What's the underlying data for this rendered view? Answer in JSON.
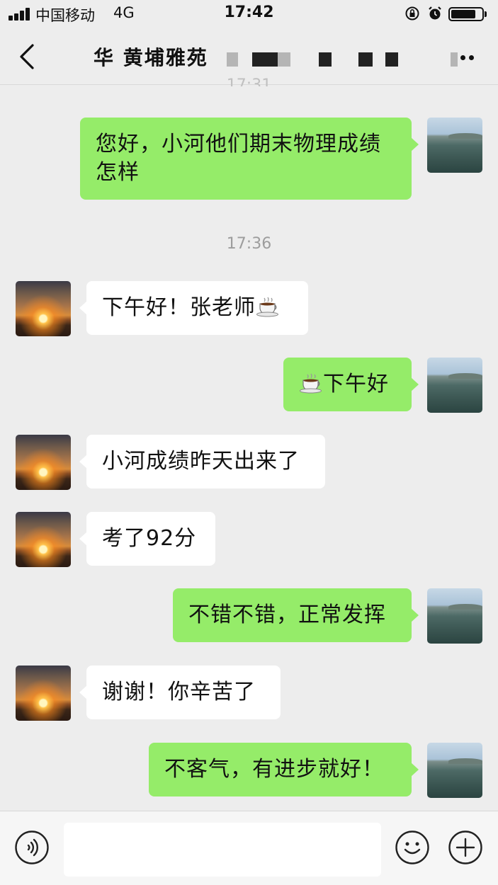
{
  "status_bar": {
    "carrier": "中国移动",
    "network": "4G",
    "time": "17:42",
    "battery_level": 0.8
  },
  "header": {
    "title": "华 黄埔雅苑",
    "back_icon": "chevron-left-icon",
    "more_icon": "more-icon"
  },
  "ghost_time": "17:31",
  "messages": [
    {
      "side": "out",
      "text": "您好，小河他们期末物理成绩\n怎样"
    },
    {
      "type": "time",
      "text": "17:36"
    },
    {
      "side": "in",
      "text": "下午好！张老师",
      "emoji": "coffee-icon"
    },
    {
      "side": "out",
      "text": "下午好",
      "emoji": "coffee-icon"
    },
    {
      "side": "in",
      "text": "小河成绩昨天出来了"
    },
    {
      "side": "in",
      "text": "考了92分"
    },
    {
      "side": "out",
      "text": "不错不错，正常发挥"
    },
    {
      "side": "in",
      "text": "谢谢！你辛苦了"
    },
    {
      "side": "out",
      "text": "不客气，有进步就好！"
    }
  ],
  "input_bar": {
    "placeholder": "",
    "voice_icon": "voice-icon",
    "emoji_icon": "emoji-icon",
    "plus_icon": "plus-icon"
  },
  "colors": {
    "background": "#ededed",
    "out_bubble": "#95ec69",
    "in_bubble": "#ffffff"
  }
}
